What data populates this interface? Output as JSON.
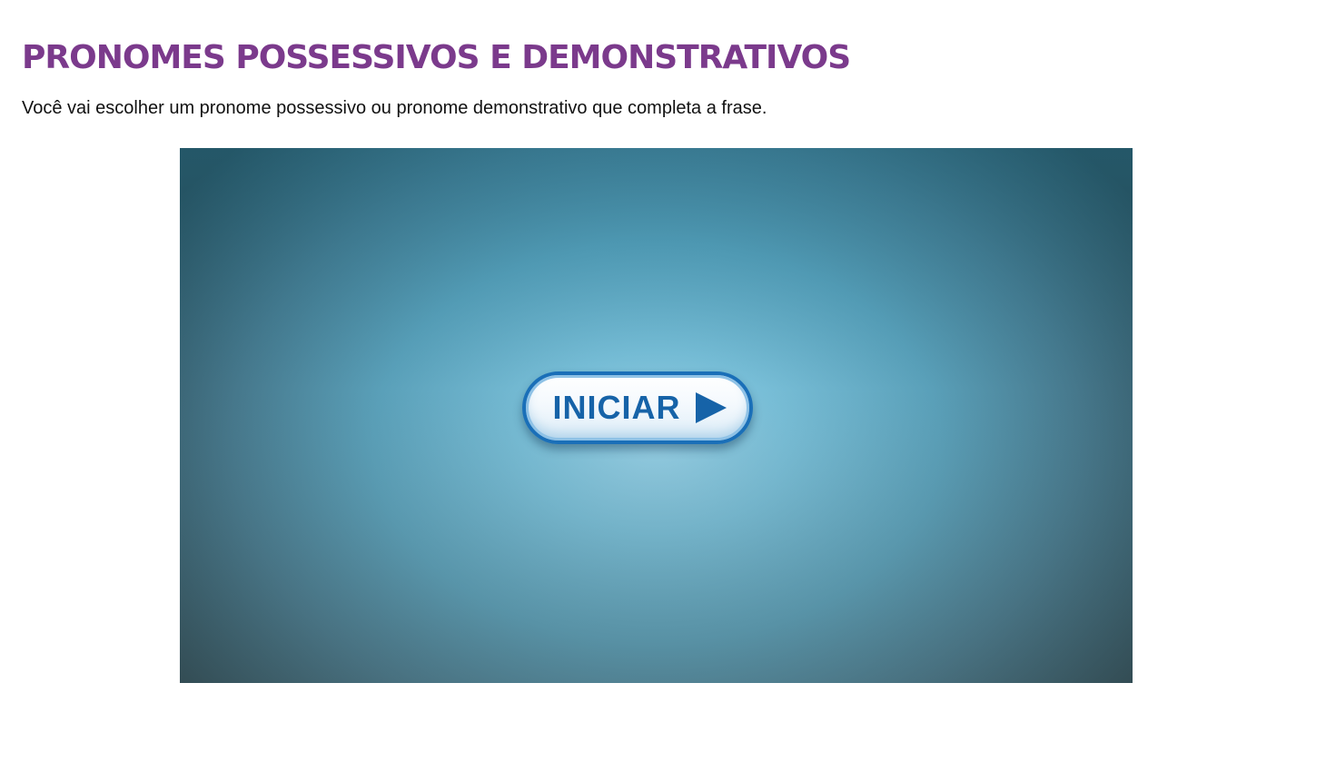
{
  "page": {
    "title": "PRONOMES POSSESSIVOS E DEMONSTRATIVOS",
    "instructions": "Você vai escolher um pronome possessivo ou pronome demonstrativo que completa a frase."
  },
  "game": {
    "start_button": {
      "label": "INICIAR",
      "icon": "play-icon"
    }
  },
  "colors": {
    "title": "#7b3a8c",
    "button_text": "#1663a8",
    "button_border": "#1a6fb8",
    "stage_center": "#96d0e6",
    "stage_edge": "#28464f"
  }
}
